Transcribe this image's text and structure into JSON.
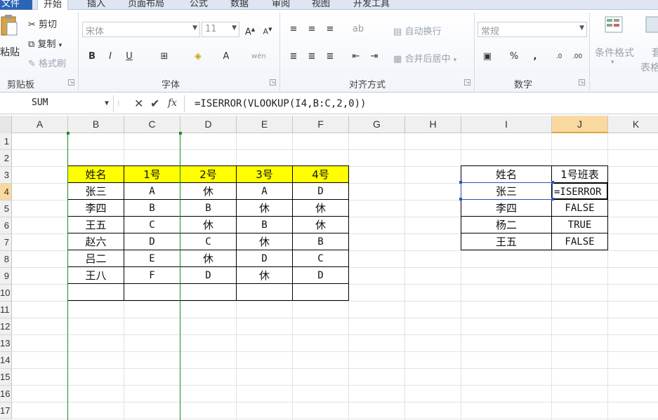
{
  "ribbon_tabs": [
    "文件",
    "开始",
    "插入",
    "页面布局",
    "公式",
    "数据",
    "审阅",
    "视图",
    "开发工具"
  ],
  "clipboard": {
    "paste": "粘贴",
    "cut": "剪切",
    "copy": "复制",
    "format_painter": "格式刷",
    "group": "剪贴板"
  },
  "font": {
    "name": "宋体",
    "size": "11",
    "bold": "B",
    "italic": "I",
    "underline": "U",
    "group": "字体"
  },
  "alignment": {
    "wrap": "自动换行",
    "merge": "合并后居中",
    "group": "对齐方式"
  },
  "number": {
    "format": "常规",
    "percent": "%",
    "comma": ",",
    "group": "数字"
  },
  "styles": {
    "conditional": "条件格式",
    "table": "表格",
    "table_short": "套"
  },
  "formula_bar": {
    "name_box": "SUM",
    "fx": "fx",
    "formula": "=ISERROR(VLOOKUP(I4,B:C,2,0))"
  },
  "columns": [
    "A",
    "B",
    "C",
    "D",
    "E",
    "F",
    "G",
    "H",
    "I",
    "J",
    "K"
  ],
  "rows": [
    "1",
    "2",
    "3",
    "4",
    "5",
    "6",
    "7",
    "8",
    "9",
    "10",
    "11",
    "12",
    "13",
    "14",
    "15",
    "16",
    "17"
  ],
  "schedule_table": {
    "headers": [
      "姓名",
      "1号",
      "2号",
      "3号",
      "4号"
    ],
    "rows": [
      [
        "张三",
        "A",
        "休",
        "A",
        "D"
      ],
      [
        "李四",
        "B",
        "B",
        "休",
        "休"
      ],
      [
        "王五",
        "C",
        "休",
        "B",
        "休"
      ],
      [
        "赵六",
        "D",
        "C",
        "休",
        "B"
      ],
      [
        "吕二",
        "E",
        "休",
        "D",
        "C"
      ],
      [
        "王八",
        "F",
        "D",
        "休",
        "D"
      ],
      [
        "",
        "",
        "",
        "",
        ""
      ]
    ]
  },
  "lookup_table": {
    "headers": [
      "姓名",
      "1号班表"
    ],
    "rows": [
      [
        "张三",
        "=ISERROR"
      ],
      [
        "李四",
        "FALSE"
      ],
      [
        "杨二",
        "TRUE"
      ],
      [
        "王五",
        "FALSE"
      ]
    ]
  },
  "colors": {
    "header_fill": "#ffff00",
    "selection": "#2a52be",
    "trace_line": "#1f8a1f",
    "active_header": "#f9d99f"
  }
}
